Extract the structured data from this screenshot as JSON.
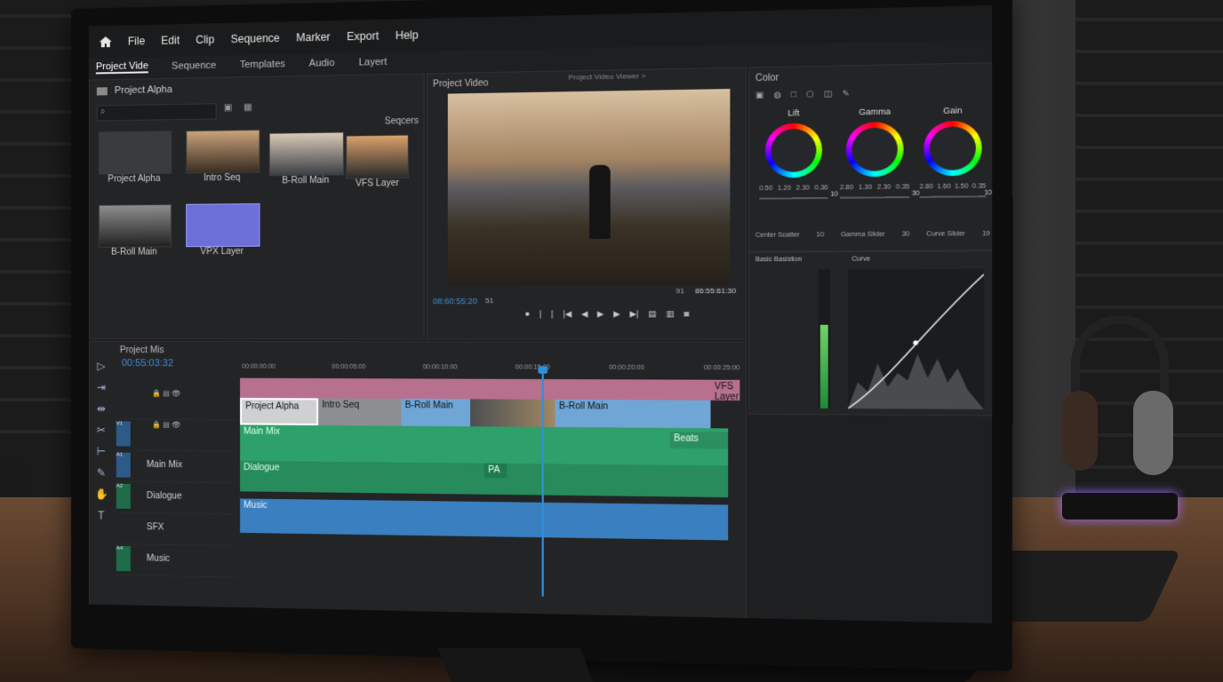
{
  "menu": [
    "File",
    "Edit",
    "Clip",
    "Sequence",
    "Marker",
    "Export",
    "Help"
  ],
  "tabs": [
    {
      "label": "Project Vide"
    },
    {
      "label": "Sequence"
    },
    {
      "label": "Templates"
    },
    {
      "label": "Audio"
    },
    {
      "label": "Layert"
    }
  ],
  "project": {
    "folder_label": "Project Alpha",
    "search_placeholder": "",
    "sequences_label": "Seqcers",
    "items": [
      {
        "name": "Project Alpha",
        "kind": "folder"
      },
      {
        "name": "Intro Seq",
        "kind": "clip"
      },
      {
        "name": "B-Roll Main",
        "kind": "clip"
      },
      {
        "name": "VFS Layer",
        "kind": "clip"
      },
      {
        "name": "B-Roll Main",
        "kind": "clip"
      },
      {
        "name": "VPX Layer",
        "kind": "clip"
      }
    ]
  },
  "viewer": {
    "title": "Project Video",
    "subtitle": "Project Video Viewer >",
    "timecode_left": "08:60:55:20",
    "zoom": "51",
    "timecode_right": "86:55:61:30",
    "page_num": "91"
  },
  "color": {
    "title": "Color",
    "wheels": [
      {
        "name": "Lift",
        "values": [
          "0.50",
          "1.20",
          "2.30",
          "0.36"
        ],
        "slider": "10"
      },
      {
        "name": "Gamma",
        "values": [
          "2.80",
          "1.30",
          "2.30",
          "0.35"
        ],
        "slider": "30"
      },
      {
        "name": "Gain",
        "values": [
          "2.80",
          "1.60",
          "1.50",
          "0.35"
        ],
        "slider": "10"
      }
    ],
    "bottom": [
      {
        "label": "Center Scatter",
        "value": "10"
      },
      {
        "label": "Gamma Slider",
        "value": "30"
      },
      {
        "label": "Curve Slider",
        "value": "19"
      }
    ],
    "basic_label": "Basic Basistion",
    "curve_label": "Curve"
  },
  "timeline": {
    "title": "Project Mis",
    "timecode": "00:55:03:32",
    "ruler": [
      "00:00:00:00",
      "00:00:05:00",
      "00:00:10:00",
      "00:00:15:00",
      "00:00:20:00",
      "00:00:25:00"
    ],
    "tracks": [
      {
        "name": "",
        "id": "V1"
      },
      {
        "name": "",
        "id": "V1"
      },
      {
        "name": "Main Mix",
        "id": "A1"
      },
      {
        "name": "Dialogue",
        "id": "A2"
      },
      {
        "name": "SFX",
        "id": "A3"
      },
      {
        "name": "Music",
        "id": "A4"
      }
    ],
    "clips": [
      {
        "label": "Project Alpha"
      },
      {
        "label": "Intro Seq"
      },
      {
        "label": "B-Roll Main"
      },
      {
        "label": "B-Roll Main"
      },
      {
        "label": "VFS Layer"
      },
      {
        "label": "Main Mix"
      },
      {
        "label": "Dialogue"
      },
      {
        "label": "PA"
      },
      {
        "label": "Beats"
      },
      {
        "label": "Music"
      }
    ]
  },
  "colors": {
    "accent": "#2f8fe0",
    "pink": "#b86c8f",
    "clip_blue": "#6fa6d6",
    "audio_green": "#2ea06a",
    "music_blue": "#3a7fbf"
  }
}
